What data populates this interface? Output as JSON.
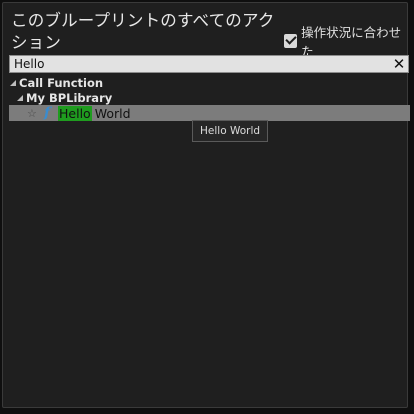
{
  "header": {
    "title": "このブループリントのすべてのアクション",
    "context_sensitive_label": "操作状況に合わせた",
    "context_sensitive_checked": true
  },
  "search": {
    "value": "Hello",
    "clear_icon": "close-icon"
  },
  "tree": {
    "category": "Call Function",
    "subcategory": "My BPLibrary",
    "item": {
      "highlight": "Hello",
      "rest": "World",
      "favorite_icon": "star-icon",
      "function_icon": "function-icon"
    }
  },
  "tooltip": {
    "text": "Hello World"
  },
  "colors": {
    "panel_bg": "#1f1f1f",
    "selection_bg": "#7c7c7c",
    "match_highlight": "#1f9c1f",
    "function_icon": "#3a8ccf"
  }
}
